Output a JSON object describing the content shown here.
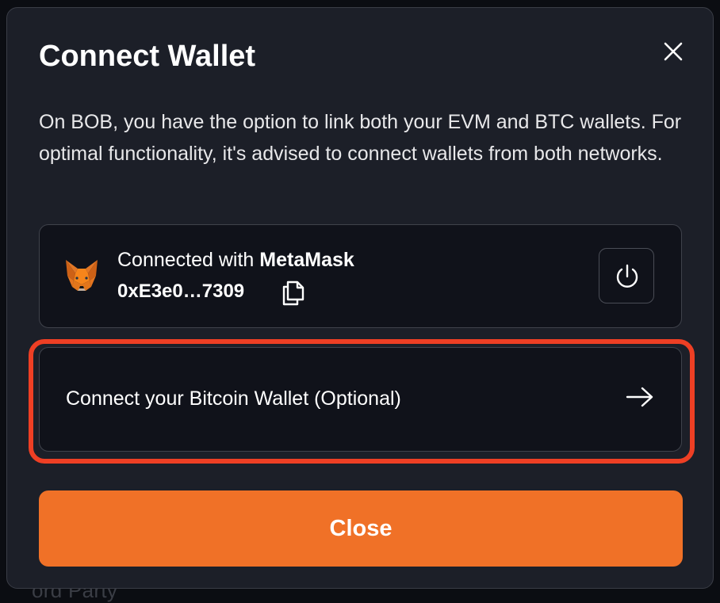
{
  "background": {
    "partial_text": "ord Party"
  },
  "modal": {
    "title": "Connect Wallet",
    "description": "On BOB, you have the option to link both your EVM and BTC wallets. For optimal functionality, it's advised to connect wallets from both networks.",
    "connected_wallet": {
      "prefix": "Connected with ",
      "wallet_name": "MetaMask",
      "address": "0xE3e0…7309",
      "icon": "metamask-fox-icon"
    },
    "bitcoin_wallet": {
      "label": "Connect your Bitcoin Wallet (Optional)",
      "icon": "arrow-right-icon"
    },
    "close_button_label": "Close"
  },
  "colors": {
    "accent": "#f07127",
    "highlight": "#ee3f24",
    "modal_bg": "#1c1f28",
    "card_bg": "#10121a"
  }
}
